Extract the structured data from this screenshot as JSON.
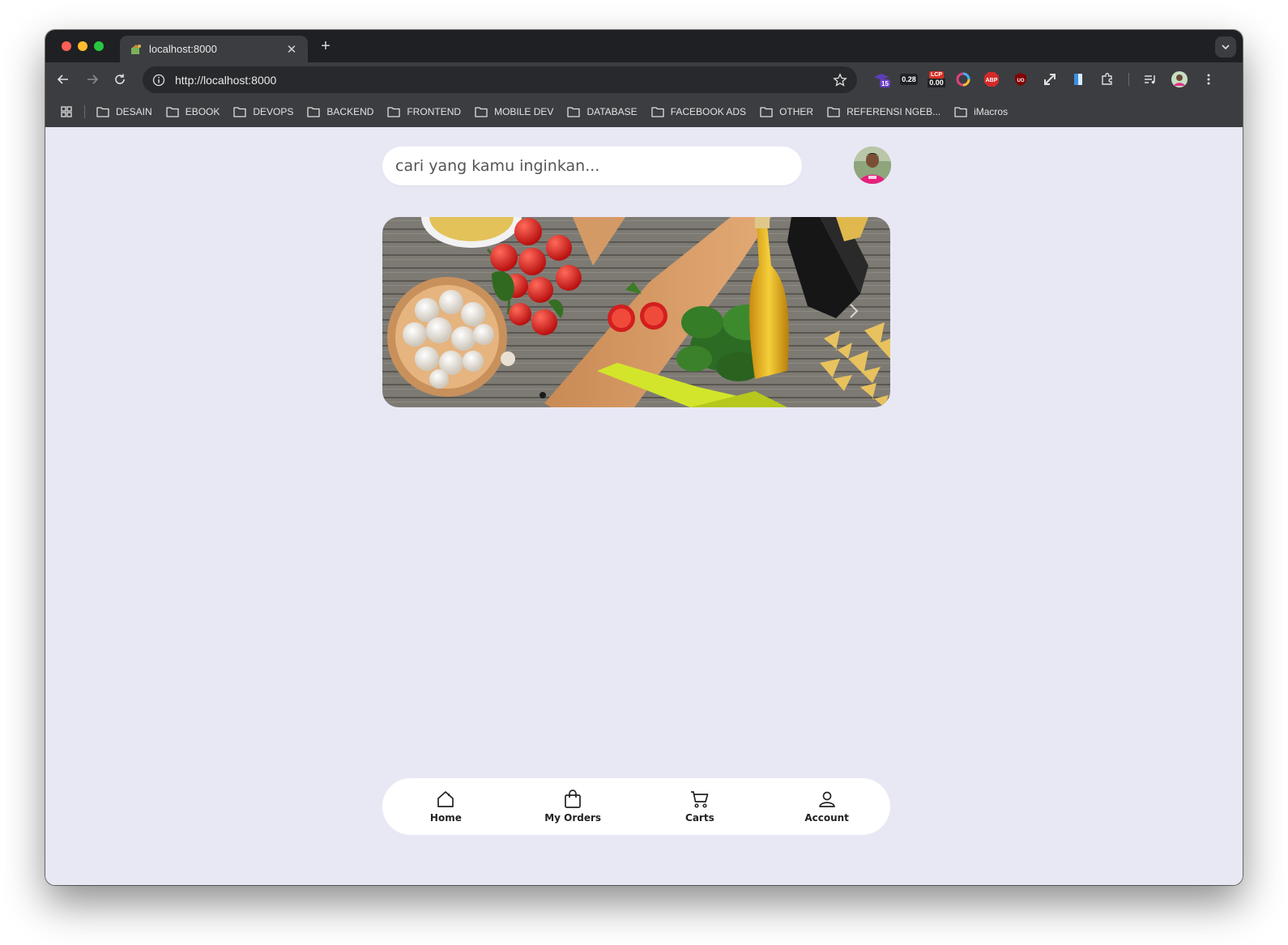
{
  "browser": {
    "tab_title": "localhost:8000",
    "url": "http://localhost:8000",
    "extensions": {
      "badge_count": "15",
      "cls_value": "0.28",
      "lcp_label": "LCP",
      "lcp_value": "0.00",
      "abp_label": "ABP",
      "ublock_label": "UO"
    },
    "bookmarks": [
      {
        "label": "DESAIN"
      },
      {
        "label": "EBOOK"
      },
      {
        "label": "DEVOPS"
      },
      {
        "label": "BACKEND"
      },
      {
        "label": "FRONTEND"
      },
      {
        "label": "MOBILE DEV"
      },
      {
        "label": "DATABASE"
      },
      {
        "label": "FACEBOOK ADS"
      },
      {
        "label": "OTHER"
      },
      {
        "label": "REFERENSI NGEB..."
      },
      {
        "label": "iMacros"
      }
    ]
  },
  "page": {
    "search_placeholder": "cari yang kamu inginkan...",
    "nav": [
      {
        "label": "Home",
        "icon": "home-icon"
      },
      {
        "label": "My Orders",
        "icon": "bag-icon"
      },
      {
        "label": "Carts",
        "icon": "cart-icon"
      },
      {
        "label": "Account",
        "icon": "user-icon"
      }
    ]
  },
  "colors": {
    "page_background": "#e8e8f5",
    "chrome_dark": "#3c3d41",
    "tab_strip": "#1f2023"
  }
}
